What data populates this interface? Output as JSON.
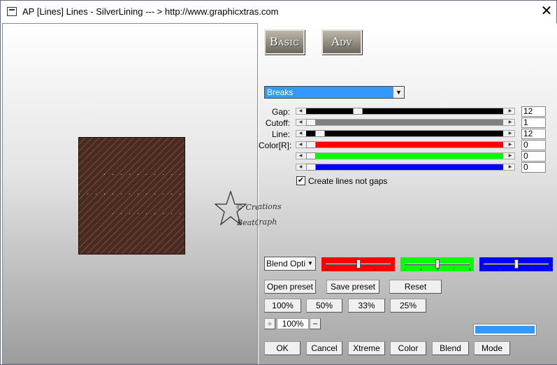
{
  "window": {
    "title": "AP [Lines]  Lines - SilverLining    --- > http://www.graphicxtras.com",
    "close_label": "✕"
  },
  "watermark": {
    "line1": "© Creations",
    "line2": "BeatGraph"
  },
  "mode_tabs": {
    "basic": "Basic",
    "adv": "Adv"
  },
  "effect_dropdown": {
    "selected": "Breaks",
    "arrow": "▼"
  },
  "params": [
    {
      "label": "Gap:",
      "value": "12",
      "fraction": 0.25,
      "track_color": "#000000"
    },
    {
      "label": "Cutoff:",
      "value": "1",
      "fraction": 0.0,
      "track_color": "#808080"
    },
    {
      "label": "Line:",
      "value": "12",
      "fraction": 0.05,
      "track_color": "#000000"
    },
    {
      "label": "Color[R]:",
      "value": "0",
      "fraction": 0.0,
      "track_color": "#ff0000"
    },
    {
      "label": "",
      "value": "0",
      "fraction": 0.0,
      "track_color": "#00ff00"
    },
    {
      "label": "",
      "value": "0",
      "fraction": 0.0,
      "track_color": "#0000ff"
    }
  ],
  "create_lines": {
    "checked_mark": "✔",
    "label": "Create lines not gaps"
  },
  "blend": {
    "selected": "Blend Options",
    "arrow": "▼"
  },
  "color_sliders": [
    {
      "name": "red",
      "color": "#ff0000",
      "fraction": 0.5
    },
    {
      "name": "green",
      "color": "#00ff00",
      "fraction": 0.5
    },
    {
      "name": "blue",
      "color": "#0000ff",
      "fraction": 0.5
    }
  ],
  "preset_buttons": {
    "open": "Open preset",
    "save": "Save preset",
    "reset": "Reset"
  },
  "zoom_buttons": [
    "100%",
    "50%",
    "33%",
    "25%"
  ],
  "zoom": {
    "plus": "+",
    "value": "100%",
    "minus": "−"
  },
  "swatch_color": "#3399ff",
  "bottom_buttons": [
    "OK",
    "Cancel",
    "Xtreme",
    "Color",
    "Blend",
    "Mode"
  ]
}
